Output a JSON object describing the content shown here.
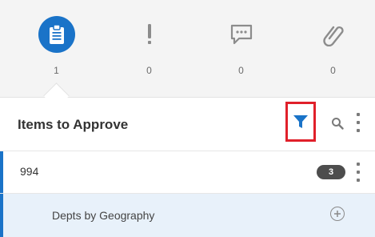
{
  "tabs": [
    {
      "name": "approvals",
      "icon": "clipboard-icon",
      "count": "1",
      "active": true
    },
    {
      "name": "alerts",
      "icon": "exclamation-icon",
      "count": "0",
      "active": false
    },
    {
      "name": "comments",
      "icon": "chat-bubble-icon",
      "count": "0",
      "active": false
    },
    {
      "name": "attachments",
      "icon": "paperclip-icon",
      "count": "0",
      "active": false
    }
  ],
  "header": {
    "title": "Items to Approve"
  },
  "list": {
    "item": {
      "label": "994",
      "badge": "3"
    },
    "subitem": {
      "label": "Depts by Geography"
    }
  },
  "colors": {
    "accent": "#1a73c8",
    "highlight_border": "#e0202a",
    "subrow_bg": "#e8f1fa",
    "badge_bg": "#4d4d4d"
  }
}
